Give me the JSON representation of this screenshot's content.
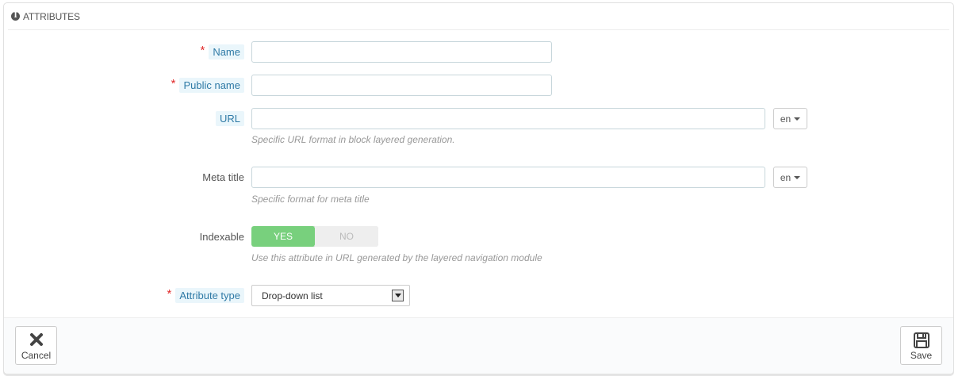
{
  "panel": {
    "title": "ATTRIBUTES",
    "icon": "info-icon"
  },
  "fields": {
    "name": {
      "label": "Name",
      "required": true,
      "value": ""
    },
    "public_name": {
      "label": "Public name",
      "required": true,
      "value": ""
    },
    "url": {
      "label": "URL",
      "value": "",
      "lang": "en",
      "help": "Specific URL format in block layered generation."
    },
    "meta_title": {
      "label": "Meta title",
      "value": "",
      "lang": "en",
      "help": "Specific format for meta title"
    },
    "indexable": {
      "label": "Indexable",
      "yes": "YES",
      "no": "NO",
      "selected": "YES",
      "help": "Use this attribute in URL generated by the layered navigation module"
    },
    "attribute_type": {
      "label": "Attribute type",
      "required": true,
      "value": "Drop-down list"
    }
  },
  "footer": {
    "cancel_label": "Cancel",
    "save_label": "Save"
  },
  "colors": {
    "accent_green": "#78d07d",
    "required_red": "#e12b2b",
    "tip_blue": "#2f7aa6"
  }
}
